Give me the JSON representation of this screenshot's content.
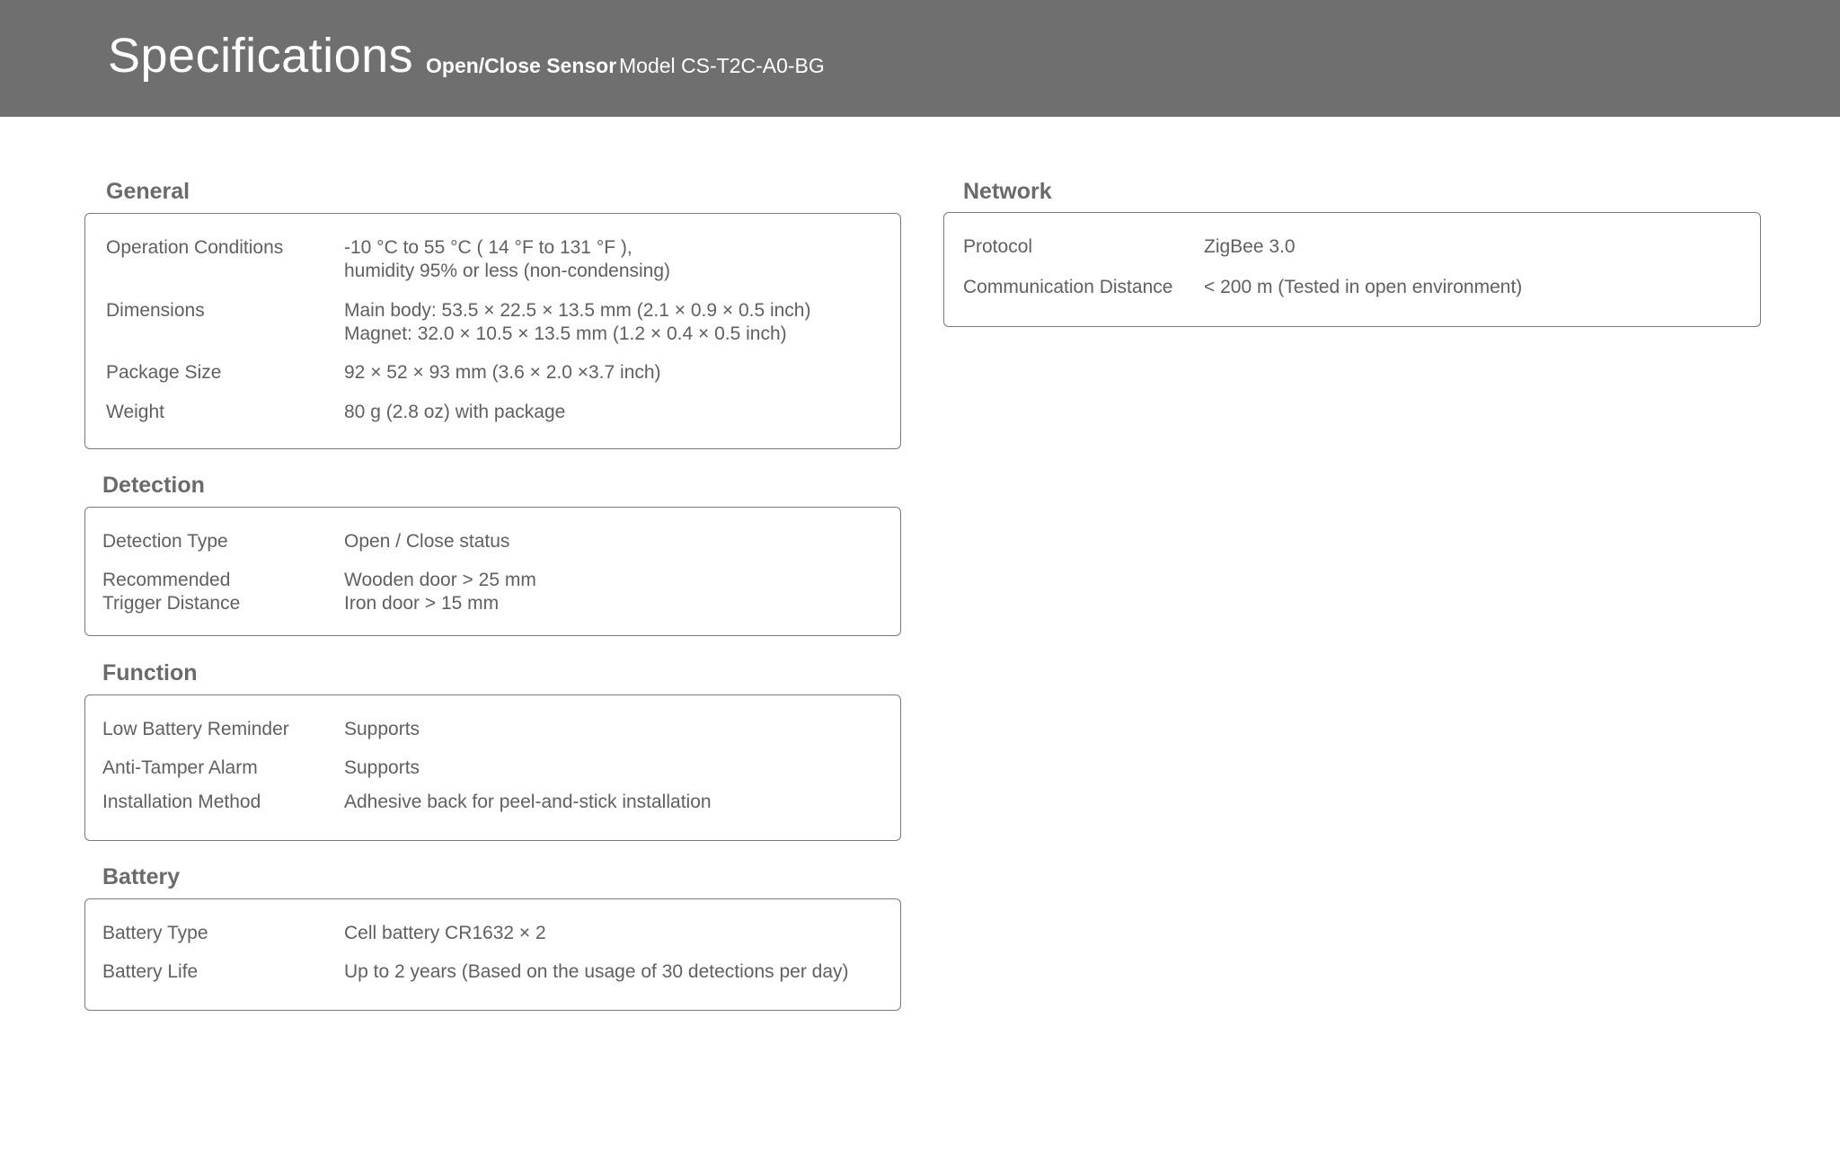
{
  "header": {
    "title": "Specifications",
    "product": "Open/Close Sensor",
    "model": "Model CS-T2C-A0-BG"
  },
  "general": {
    "title": "General",
    "rows": [
      {
        "label": "Operation Conditions",
        "value": [
          "-10 °C to 55 °C ( 14 °F to 131 °F ),",
          "humidity 95% or less (non-condensing)"
        ]
      },
      {
        "label": "Dimensions",
        "value": [
          "Main body: 53.5 × 22.5 × 13.5 mm (2.1 × 0.9 × 0.5 inch)",
          "Magnet: 32.0 × 10.5 × 13.5 mm (1.2 × 0.4 × 0.5 inch)"
        ]
      },
      {
        "label": "Package Size",
        "value": [
          "92 × 52 × 93 mm (3.6 × 2.0 ×3.7 inch)"
        ]
      },
      {
        "label": "Weight",
        "value": [
          "80 g (2.8 oz) with package"
        ]
      }
    ]
  },
  "detection": {
    "title": "Detection",
    "rows": [
      {
        "label": [
          "Detection Type"
        ],
        "value": [
          "Open / Close status"
        ]
      },
      {
        "label": [
          "Recommended",
          "Trigger Distance"
        ],
        "value": [
          "Wooden door > 25 mm",
          "Iron door > 15 mm"
        ]
      }
    ]
  },
  "function": {
    "title": "Function",
    "rows": [
      {
        "label": "Low Battery Reminder",
        "value": "Supports"
      },
      {
        "label": "Anti-Tamper Alarm",
        "value": "Supports"
      },
      {
        "label": "Installation Method",
        "value": "Adhesive back for peel-and-stick installation"
      }
    ]
  },
  "battery": {
    "title": "Battery",
    "rows": [
      {
        "label": "Battery Type",
        "value": "Cell battery CR1632 × 2"
      },
      {
        "label": "Battery Life",
        "value": "Up to 2 years (Based on the usage of 30 detections per day)"
      }
    ]
  },
  "network": {
    "title": "Network",
    "rows": [
      {
        "label": "Protocol",
        "value": "ZigBee 3.0"
      },
      {
        "label": "Communication Distance",
        "value": "< 200 m (Tested in open environment)"
      }
    ]
  }
}
